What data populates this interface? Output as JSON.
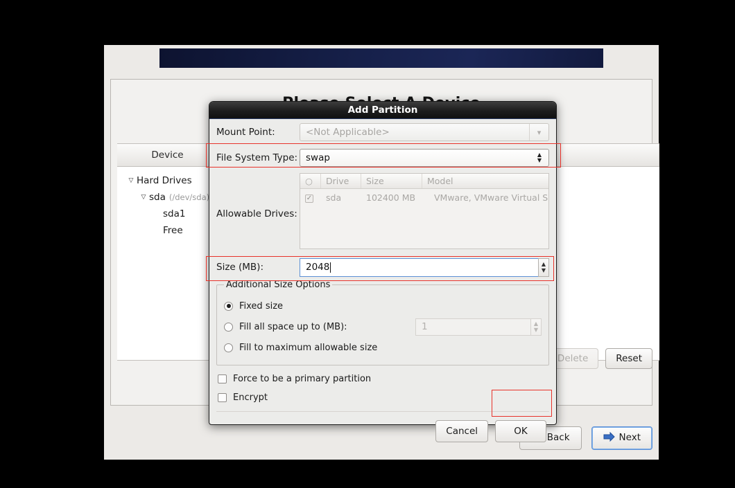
{
  "installer": {
    "heading": "Please Select A Device",
    "device_table": {
      "columns": [
        "Device",
        ""
      ],
      "tree": [
        {
          "label": "Hard Drives",
          "sub": "",
          "indent": 0,
          "twisty": "▽"
        },
        {
          "label": "sda",
          "sub": "(/dev/sda)",
          "indent": 1,
          "twisty": "▽"
        },
        {
          "label": "sda1",
          "sub": "",
          "indent": 2,
          "twisty": ""
        },
        {
          "label": "Free",
          "sub": "",
          "indent": 2,
          "twisty": ""
        }
      ]
    },
    "buttons": {
      "delete": "Delete",
      "reset": "Reset",
      "back": "Back",
      "next": "Next"
    }
  },
  "dialog": {
    "title": "Add Partition",
    "mount_point": {
      "label": "Mount Point:",
      "value": "<Not Applicable>",
      "enabled": false
    },
    "file_system_type": {
      "label": "File System Type:",
      "value": "swap",
      "enabled": true
    },
    "allowable_drives": {
      "label": "Allowable Drives:",
      "columns": [
        "○",
        "Drive",
        "Size",
        "Model"
      ],
      "rows": [
        {
          "checked": true,
          "drive": "sda",
          "size": "102400 MB",
          "model": "VMware, VMware Virtual S"
        }
      ]
    },
    "size": {
      "label": "Size (MB):",
      "value": "2048"
    },
    "additional_size_options": {
      "legend": "Additional Size Options",
      "options": [
        {
          "label": "Fixed size",
          "selected": true
        },
        {
          "label": "Fill all space up to (MB):",
          "selected": false,
          "value": "1"
        },
        {
          "label": "Fill to maximum allowable size",
          "selected": false
        }
      ]
    },
    "checkboxes": [
      {
        "label": "Force to be a primary partition",
        "checked": false
      },
      {
        "label": "Encrypt",
        "checked": false
      }
    ],
    "buttons": {
      "cancel": "Cancel",
      "ok": "OK"
    }
  },
  "colors": {
    "accent_red": "#e8322a",
    "banner": "#16204a",
    "focus_blue": "#5b8fd6"
  }
}
